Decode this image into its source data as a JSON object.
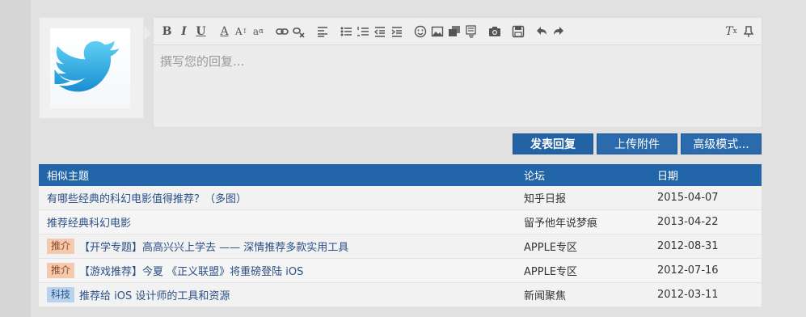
{
  "editor": {
    "placeholder": "撰写您的回复...",
    "toolbar_icons": [
      "bold-icon",
      "italic-icon",
      "underline-icon",
      "font-color-icon",
      "font-size-icon",
      "font-family-icon",
      "link-icon",
      "unlink-icon",
      "align-icon",
      "bulleted-list-icon",
      "numbered-list-icon",
      "outdent-icon",
      "indent-icon",
      "emoji-icon",
      "image-icon",
      "multi-image-icon",
      "code-icon",
      "camera-icon",
      "save-icon",
      "undo-icon",
      "redo-icon",
      "clear-format-icon",
      "pin-icon"
    ]
  },
  "buttons": {
    "post": "发表回复",
    "upload": "上传附件",
    "advanced": "高级模式..."
  },
  "table": {
    "headers": {
      "topic": "相似主题",
      "forum": "论坛",
      "date": "日期"
    },
    "rows": [
      {
        "badge": "",
        "title": "有哪些经典的科幻电影值得推荐？（多图）",
        "forum": "知乎日报",
        "date": "2015-04-07"
      },
      {
        "badge": "",
        "title": "推荐经典科幻电影",
        "forum": "留予他年说梦痕",
        "date": "2013-04-22"
      },
      {
        "badge": "推介",
        "title": "【开学专题】高高兴兴上学去 —— 深情推荐多款实用工具",
        "forum": "APPLE专区",
        "date": "2012-08-31"
      },
      {
        "badge": "推介",
        "title": "【游戏推荐】今夏 《正义联盟》将重磅登陆 iOS",
        "forum": "APPLE专区",
        "date": "2012-07-16"
      },
      {
        "badge": "科技",
        "title": "推荐给 iOS 设计师的工具和资源",
        "forum": "新闻聚焦",
        "date": "2012-03-11"
      }
    ]
  },
  "colors": {
    "header_bg": "#2266a9",
    "button_bg": "#2b6bad",
    "link": "#2a4f86"
  }
}
